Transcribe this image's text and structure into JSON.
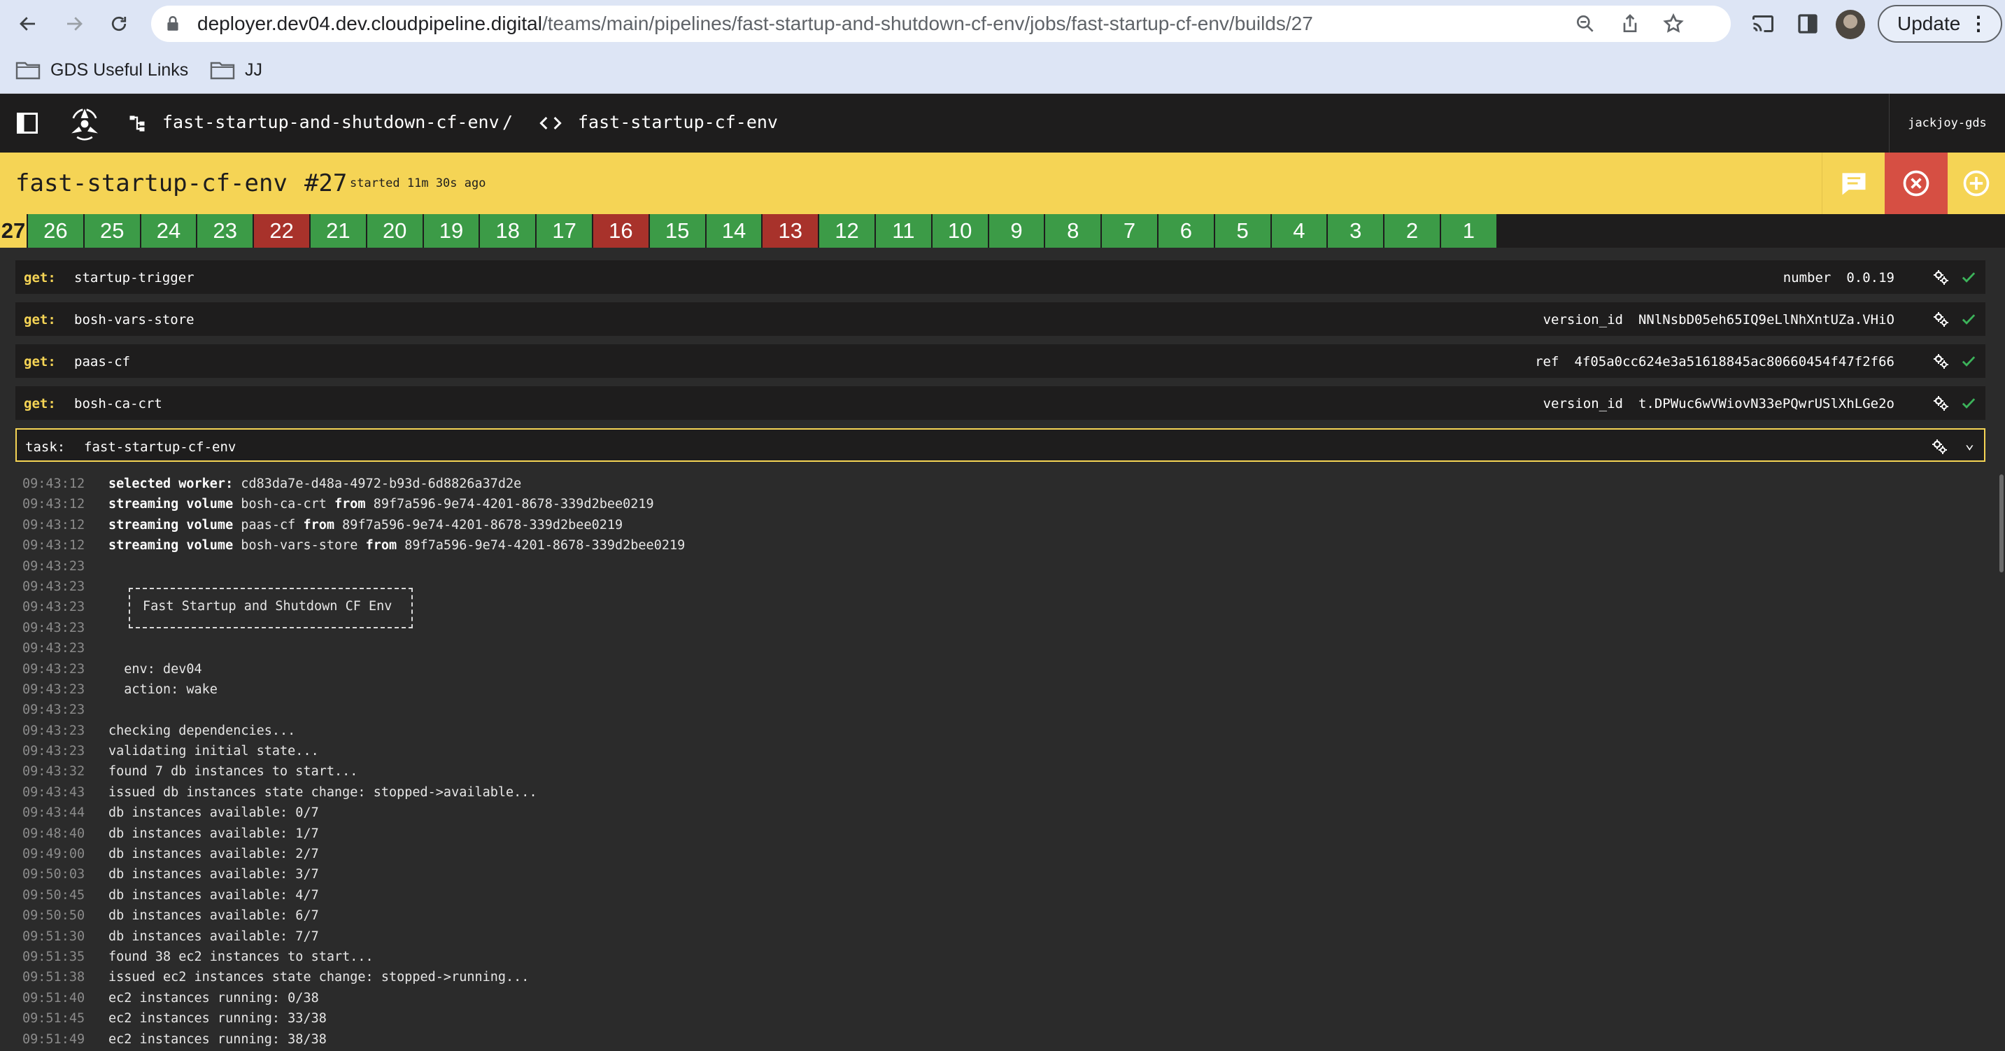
{
  "browser": {
    "url_domain": "deployer.dev04.dev.cloudpipeline.digital",
    "url_path": "/teams/main/pipelines/fast-startup-and-shutdown-cf-env/jobs/fast-startup-cf-env/builds/27",
    "update_label": "Update",
    "bookmarks": [
      {
        "label": "GDS Useful Links"
      },
      {
        "label": "JJ"
      }
    ]
  },
  "topbar": {
    "pipeline": "fast-startup-and-shutdown-cf-env",
    "separator": "/",
    "job": "fast-startup-cf-env",
    "user": "jackjoy-gds"
  },
  "build": {
    "job_name": "fast-startup-cf-env",
    "number": "#27",
    "started": "started 11m 30s ago",
    "status_color": "#f5d455"
  },
  "tabs": [
    {
      "label": "27",
      "status": "current"
    },
    {
      "label": "26",
      "status": "succeeded"
    },
    {
      "label": "25",
      "status": "succeeded"
    },
    {
      "label": "24",
      "status": "succeeded"
    },
    {
      "label": "23",
      "status": "succeeded"
    },
    {
      "label": "22",
      "status": "failed"
    },
    {
      "label": "21",
      "status": "succeeded"
    },
    {
      "label": "20",
      "status": "succeeded"
    },
    {
      "label": "19",
      "status": "succeeded"
    },
    {
      "label": "18",
      "status": "succeeded"
    },
    {
      "label": "17",
      "status": "succeeded"
    },
    {
      "label": "16",
      "status": "failed"
    },
    {
      "label": "15",
      "status": "succeeded"
    },
    {
      "label": "14",
      "status": "succeeded"
    },
    {
      "label": "13",
      "status": "failed"
    },
    {
      "label": "12",
      "status": "succeeded"
    },
    {
      "label": "11",
      "status": "succeeded"
    },
    {
      "label": "10",
      "status": "succeeded"
    },
    {
      "label": "9",
      "status": "succeeded"
    },
    {
      "label": "8",
      "status": "succeeded"
    },
    {
      "label": "7",
      "status": "succeeded"
    },
    {
      "label": "6",
      "status": "succeeded"
    },
    {
      "label": "5",
      "status": "succeeded"
    },
    {
      "label": "4",
      "status": "succeeded"
    },
    {
      "label": "3",
      "status": "succeeded"
    },
    {
      "label": "2",
      "status": "succeeded"
    },
    {
      "label": "1",
      "status": "succeeded"
    }
  ],
  "steps": [
    {
      "kind": "get:",
      "name": "startup-trigger",
      "vkey": "number",
      "vval": "0.0.19"
    },
    {
      "kind": "get:",
      "name": "bosh-vars-store",
      "vkey": "version_id",
      "vval": "NNlNsbD05eh65IQ9eLlNhXntUZa.VHiO"
    },
    {
      "kind": "get:",
      "name": "paas-cf",
      "vkey": "ref",
      "vval": "4f05a0cc624e3a51618845ac80660454f47f2f66"
    },
    {
      "kind": "get:",
      "name": "bosh-ca-crt",
      "vkey": "version_id",
      "vval": "t.DPWuc6wVWiovN33ePQwrUSlXhLGe2o"
    }
  ],
  "task": {
    "kind": "task:",
    "name": "fast-startup-cf-env"
  },
  "log": [
    {
      "ts": "09:43:12",
      "parts": [
        [
          "b",
          "selected worker:"
        ],
        [
          "t",
          " cd83da7e-d48a-4972-b93d-6d8826a37d2e"
        ]
      ]
    },
    {
      "ts": "09:43:12",
      "parts": [
        [
          "b",
          "streaming volume"
        ],
        [
          "t",
          " bosh-ca-crt "
        ],
        [
          "b",
          "from"
        ],
        [
          "t",
          " 89f7a596-9e74-4201-8678-339d2bee0219"
        ]
      ]
    },
    {
      "ts": "09:43:12",
      "parts": [
        [
          "b",
          "streaming volume"
        ],
        [
          "t",
          " paas-cf "
        ],
        [
          "b",
          "from"
        ],
        [
          "t",
          " 89f7a596-9e74-4201-8678-339d2bee0219"
        ]
      ]
    },
    {
      "ts": "09:43:12",
      "parts": [
        [
          "b",
          "streaming volume"
        ],
        [
          "t",
          " bosh-vars-store "
        ],
        [
          "b",
          "from"
        ],
        [
          "t",
          " 89f7a596-9e74-4201-8678-339d2bee0219"
        ]
      ]
    },
    {
      "ts": "09:43:23",
      "parts": []
    },
    {
      "ts": "09:43:23",
      "parts": []
    },
    {
      "ts": "09:43:23",
      "parts": []
    },
    {
      "ts": "09:43:23",
      "parts": []
    },
    {
      "ts": "09:43:23",
      "parts": []
    },
    {
      "ts": "09:43:23",
      "parts": [
        [
          "t",
          "  env: dev04"
        ]
      ]
    },
    {
      "ts": "09:43:23",
      "parts": [
        [
          "t",
          "  action: wake"
        ]
      ]
    },
    {
      "ts": "09:43:23",
      "parts": []
    },
    {
      "ts": "09:43:23",
      "parts": [
        [
          "t",
          "checking dependencies..."
        ]
      ]
    },
    {
      "ts": "09:43:23",
      "parts": [
        [
          "t",
          "validating initial state..."
        ]
      ]
    },
    {
      "ts": "09:43:32",
      "parts": [
        [
          "t",
          "found 7 db instances to start..."
        ]
      ]
    },
    {
      "ts": "09:43:43",
      "parts": [
        [
          "t",
          "issued db instances state change: stopped->available..."
        ]
      ]
    },
    {
      "ts": "09:43:44",
      "parts": [
        [
          "t",
          "db instances available: 0/7"
        ]
      ]
    },
    {
      "ts": "09:48:40",
      "parts": [
        [
          "t",
          "db instances available: 1/7"
        ]
      ]
    },
    {
      "ts": "09:49:00",
      "parts": [
        [
          "t",
          "db instances available: 2/7"
        ]
      ]
    },
    {
      "ts": "09:50:03",
      "parts": [
        [
          "t",
          "db instances available: 3/7"
        ]
      ]
    },
    {
      "ts": "09:50:45",
      "parts": [
        [
          "t",
          "db instances available: 4/7"
        ]
      ]
    },
    {
      "ts": "09:50:50",
      "parts": [
        [
          "t",
          "db instances available: 6/7"
        ]
      ]
    },
    {
      "ts": "09:51:30",
      "parts": [
        [
          "t",
          "db instances available: 7/7"
        ]
      ]
    },
    {
      "ts": "09:51:35",
      "parts": [
        [
          "t",
          "found 38 ec2 instances to start..."
        ]
      ]
    },
    {
      "ts": "09:51:38",
      "parts": [
        [
          "t",
          "issued ec2 instances state change: stopped->running..."
        ]
      ]
    },
    {
      "ts": "09:51:40",
      "parts": [
        [
          "t",
          "ec2 instances running: 0/38"
        ]
      ]
    },
    {
      "ts": "09:51:45",
      "parts": [
        [
          "t",
          "ec2 instances running: 33/38"
        ]
      ]
    },
    {
      "ts": "09:51:49",
      "parts": [
        [
          "t",
          "ec2 instances running: 38/38"
        ]
      ]
    }
  ],
  "banner": "Fast Startup and Shutdown CF Env",
  "colors": {
    "succeeded": "#3c9b47",
    "failed": "#a8322b",
    "started": "#f5d455",
    "abort": "#d64f43",
    "background": "#2b2b2b",
    "panel": "#1e1d1d"
  }
}
